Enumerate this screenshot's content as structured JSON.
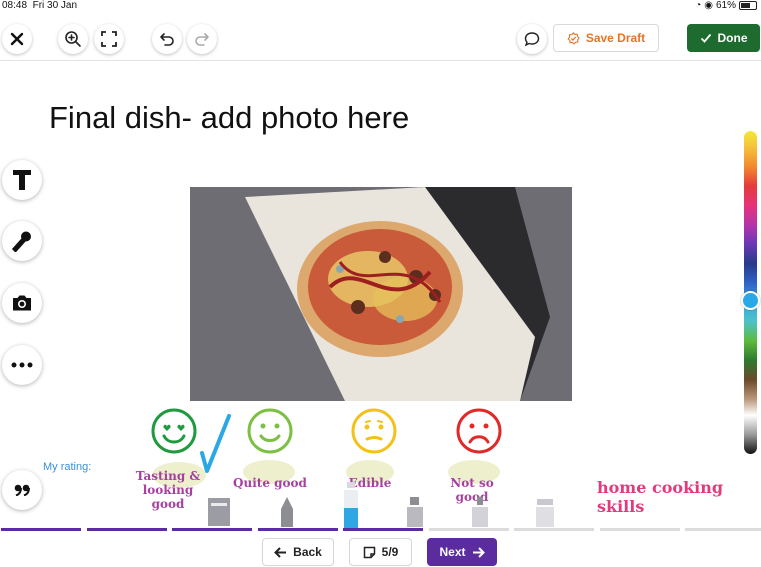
{
  "status": {
    "time": "08:48",
    "date": "Fri 30 Jan",
    "battery": "61%",
    "wifi_icon": "wifi-icon",
    "location_icon": "location-icon"
  },
  "toolbar": {
    "close_icon": "close-icon",
    "zoom_icon": "zoom-in-icon",
    "fullscreen_icon": "fullscreen-icon",
    "undo_icon": "undo-icon",
    "redo_icon": "redo-icon",
    "comment_icon": "comment-icon",
    "save_draft_label": "Save Draft",
    "done_label": "Done",
    "done_color": "#1d6b2e",
    "save_draft_color": "#e2752b"
  },
  "page": {
    "title": "Final dish- add photo here"
  },
  "tools": [
    "text-tool",
    "microphone-tool",
    "camera-tool",
    "more-tool",
    "quote-tool"
  ],
  "rating": {
    "label": "My rating:",
    "options": [
      {
        "label_line1": "Tasting &",
        "label_line2": "looking good",
        "face": "heart-eyes",
        "color": "#1f9a3f",
        "selected": true
      },
      {
        "label_line1": "Quite good",
        "label_line2": "",
        "face": "smile",
        "color": "#7cc043",
        "selected": false
      },
      {
        "label_line1": "Edible",
        "label_line2": "",
        "face": "neutral",
        "color": "#f2c21b",
        "selected": false
      },
      {
        "label_line1": "Not so good",
        "label_line2": "",
        "face": "frown",
        "color": "#e02a2a",
        "selected": false
      }
    ],
    "check_color": "#2aa8e6"
  },
  "brand": {
    "name": "home cooking skills"
  },
  "progress": {
    "completed_steps": 5,
    "total_segments": 9,
    "active_color": "#5a2ca0",
    "inactive_color": "#dcdcdc"
  },
  "color_picker": {
    "selected_color": "#2aa8e6",
    "selected_fraction": 0.52
  },
  "nav": {
    "back_label": "Back",
    "page_indicator": "5/9",
    "next_label": "Next",
    "next_color": "#5a2ca0"
  }
}
